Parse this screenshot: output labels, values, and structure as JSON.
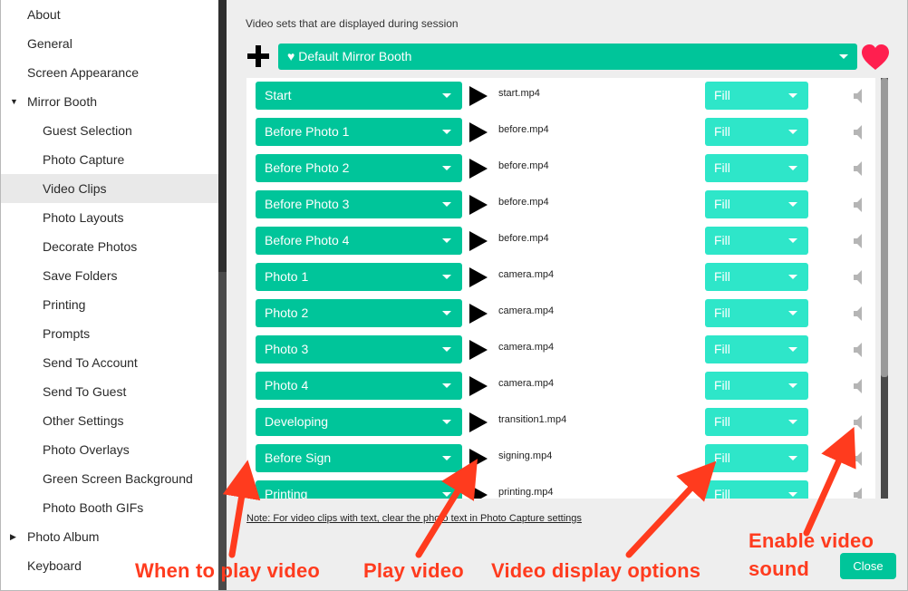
{
  "sidebar": {
    "items": [
      {
        "label": "About",
        "level": 1
      },
      {
        "label": "General",
        "level": 1
      },
      {
        "label": "Screen Appearance",
        "level": 1
      },
      {
        "label": "Mirror Booth",
        "level": 1,
        "expanded": true
      },
      {
        "label": "Guest Selection",
        "level": 2
      },
      {
        "label": "Photo Capture",
        "level": 2
      },
      {
        "label": "Video Clips",
        "level": 2,
        "active": true
      },
      {
        "label": "Photo Layouts",
        "level": 2
      },
      {
        "label": "Decorate Photos",
        "level": 2
      },
      {
        "label": "Save Folders",
        "level": 2
      },
      {
        "label": "Printing",
        "level": 2
      },
      {
        "label": "Prompts",
        "level": 2
      },
      {
        "label": "Send To Account",
        "level": 2
      },
      {
        "label": "Send To Guest",
        "level": 2
      },
      {
        "label": "Other Settings",
        "level": 2
      },
      {
        "label": "Photo Overlays",
        "level": 2
      },
      {
        "label": "Green Screen Background",
        "level": 2
      },
      {
        "label": "Photo Booth GIFs",
        "level": 2
      },
      {
        "label": "Photo Album",
        "level": 1,
        "expanded": false
      },
      {
        "label": "Keyboard",
        "level": 1
      }
    ]
  },
  "main": {
    "section_title": "Video sets that are displayed during session",
    "video_set": "♥ Default Mirror Booth",
    "clips": [
      {
        "trigger": "Start",
        "file": "start.mp4",
        "display": "Fill"
      },
      {
        "trigger": "Before Photo 1",
        "file": "before.mp4",
        "display": "Fill"
      },
      {
        "trigger": "Before Photo 2",
        "file": "before.mp4",
        "display": "Fill"
      },
      {
        "trigger": "Before Photo 3",
        "file": "before.mp4",
        "display": "Fill"
      },
      {
        "trigger": "Before Photo 4",
        "file": "before.mp4",
        "display": "Fill"
      },
      {
        "trigger": "Photo 1",
        "file": "camera.mp4",
        "display": "Fill"
      },
      {
        "trigger": "Photo 2",
        "file": "camera.mp4",
        "display": "Fill"
      },
      {
        "trigger": "Photo 3",
        "file": "camera.mp4",
        "display": "Fill"
      },
      {
        "trigger": "Photo 4",
        "file": "camera.mp4",
        "display": "Fill"
      },
      {
        "trigger": "Developing",
        "file": "transition1.mp4",
        "display": "Fill"
      },
      {
        "trigger": "Before Sign",
        "file": "signing.mp4",
        "display": "Fill"
      },
      {
        "trigger": "Printing",
        "file": "printing.mp4",
        "display": "Fill"
      }
    ],
    "note": "Note: For video clips with text, clear the photo text in Photo Capture settings",
    "close_label": "Close"
  },
  "callouts": {
    "when": "When to play video",
    "play": "Play video",
    "display": "Video display options",
    "sound_line1": "Enable video",
    "sound_line2": "sound"
  },
  "colors": {
    "accent": "#00c59a",
    "accent_light": "#2ee6c9",
    "heart": "#ff1f4f",
    "callout": "#ff3b1e"
  },
  "icons": [
    "add-icon",
    "heart-icon",
    "play-icon",
    "speaker-icon",
    "chevron-down-icon",
    "caret-down-icon",
    "caret-right-icon"
  ]
}
